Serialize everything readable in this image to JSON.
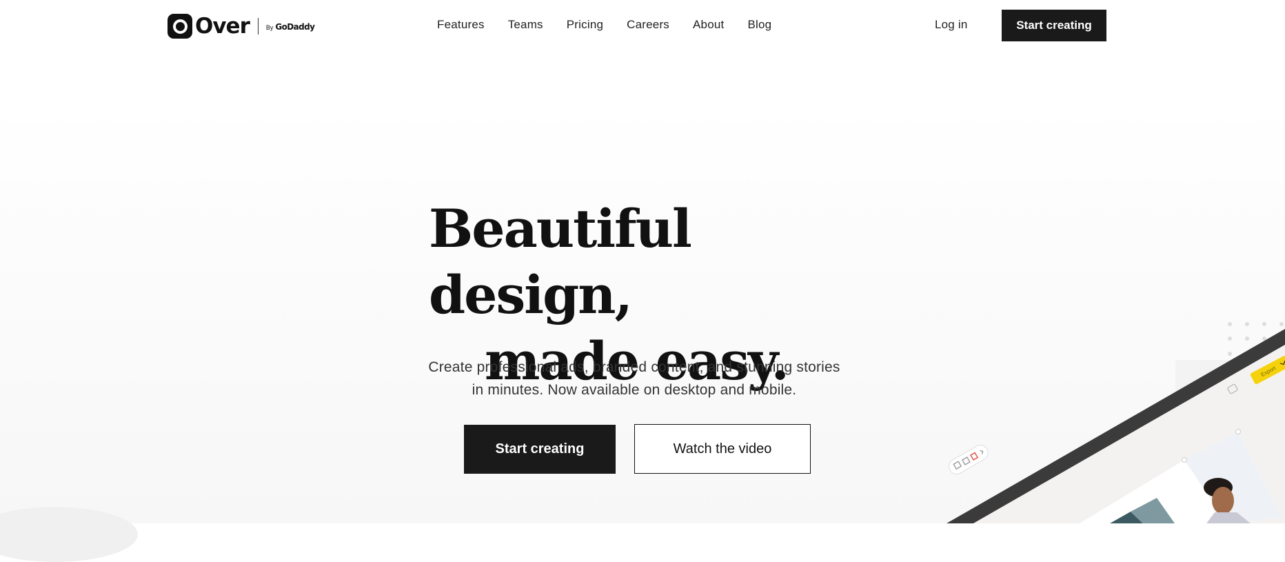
{
  "brand": {
    "name": "Over",
    "by_prefix": "By",
    "by_name": "GoDaddy"
  },
  "nav": {
    "items": [
      "Features",
      "Teams",
      "Pricing",
      "Careers",
      "About",
      "Blog"
    ],
    "login_label": "Log in",
    "cta_label": "Start creating"
  },
  "hero": {
    "headline_line1": "Beautiful design,",
    "headline_line2": "made easy.",
    "subtitle_line1": "Create professional ads, branded content, and stunning stories",
    "subtitle_line2": "in minutes. Now available on desktop and mobile.",
    "primary_cta": "Start creating",
    "secondary_cta": "Watch the video"
  },
  "editor_preview": {
    "export_label": "Export"
  },
  "colors": {
    "text": "#111111",
    "button_dark": "#1a1a1a",
    "export_yellow": "#f5d20c",
    "background": "#ffffff"
  },
  "icons": [
    "over-logo-icon",
    "chevron-down-icon",
    "layers-icon",
    "duplicate-icon",
    "crop-icon",
    "delete-icon"
  ]
}
